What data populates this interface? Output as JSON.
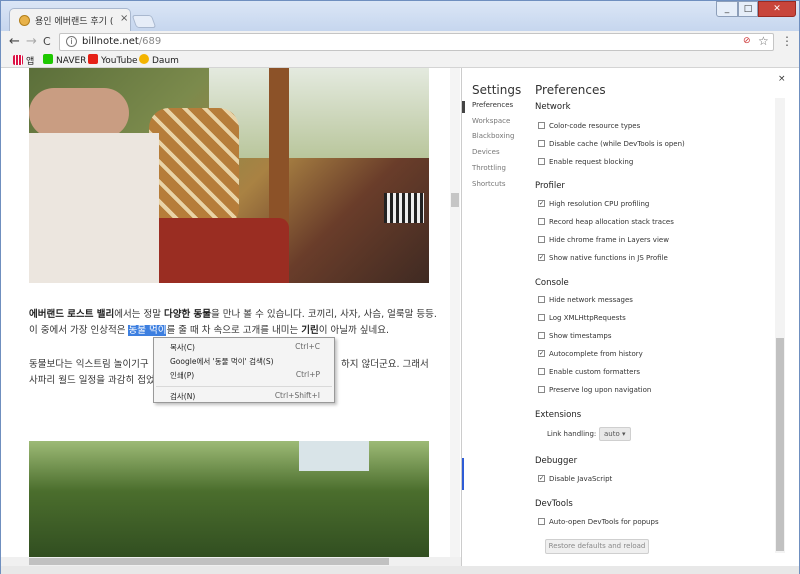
{
  "window": {
    "tab_title": "용인 에버랜드 후기 (로스",
    "tab_close": "×",
    "min_label": "_",
    "max_label": "□",
    "close_label": "✕"
  },
  "toolbar": {
    "url_host": "billnote.net",
    "url_path": "/689",
    "back": "←",
    "forward": "→",
    "reload": "C",
    "menu": "⋮",
    "star": "☆",
    "info": "i",
    "translate": "\u001a⊘"
  },
  "bookmarks": [
    {
      "label": "앱",
      "color": "#d14"
    },
    {
      "label": "NAVER",
      "color": "#1ec800"
    },
    {
      "label": "YouTube",
      "color": "#e62117"
    },
    {
      "label": "Daum",
      "color": "#f4b400"
    }
  ],
  "article": {
    "line1_a": "에버랜드 로스트 밸리",
    "line1_b": "에서는 정말 ",
    "line1_c": "다양한 동물",
    "line1_d": "을 만나 볼 수 있습니다. 코끼리, 사자, 사슴, 얼룩말 등등.",
    "line2_a": "이 중에서 가장 인상적은 ",
    "line2_sel": "동물 먹이",
    "line2_b": "를 줄 때 차 속으로 고개를 내미는 ",
    "line2_c": "기린",
    "line2_d": "이 아닐까 싶네요.",
    "line3_a": "동물보다는 익스트림 놀이기구",
    "line3_b": "하지 않더군요. 그래서",
    "line4_a": "사파리 월드 일정을 과감히 접었"
  },
  "context_menu": [
    {
      "label": "복사(C)",
      "shortcut": "Ctrl+C"
    },
    {
      "label": "Google에서 '동물 먹이' 검색(S)",
      "shortcut": ""
    },
    {
      "label": "인쇄(P)",
      "shortcut": "Ctrl+P"
    },
    {
      "label": "검사(N)",
      "shortcut": "Ctrl+Shift+I"
    }
  ],
  "devtools": {
    "close": "×",
    "settings_title": "Settings",
    "preferences_title": "Preferences",
    "side": [
      "Preferences",
      "Workspace",
      "Blackboxing",
      "Devices",
      "Throttling",
      "Shortcuts"
    ],
    "network": {
      "title": "Network",
      "options": [
        {
          "label": "Color-code resource types",
          "checked": false
        },
        {
          "label": "Disable cache (while DevTools is open)",
          "checked": false
        },
        {
          "label": "Enable request blocking",
          "checked": false
        }
      ]
    },
    "profiler": {
      "title": "Profiler",
      "options": [
        {
          "label": "High resolution CPU profiling",
          "checked": true
        },
        {
          "label": "Record heap allocation stack traces",
          "checked": false
        },
        {
          "label": "Hide chrome frame in Layers view",
          "checked": false
        },
        {
          "label": "Show native functions in JS Profile",
          "checked": true
        }
      ]
    },
    "console": {
      "title": "Console",
      "options": [
        {
          "label": "Hide network messages",
          "checked": false
        },
        {
          "label": "Log XMLHttpRequests",
          "checked": false
        },
        {
          "label": "Show timestamps",
          "checked": false
        },
        {
          "label": "Autocomplete from history",
          "checked": true
        },
        {
          "label": "Enable custom formatters",
          "checked": false
        },
        {
          "label": "Preserve log upon navigation",
          "checked": false
        }
      ]
    },
    "extensions": {
      "title": "Extensions",
      "link_handling_label": "Link handling:",
      "link_handling_value": "auto"
    },
    "debugger": {
      "title": "Debugger",
      "options": [
        {
          "label": "Disable JavaScript",
          "checked": true
        }
      ]
    },
    "devtools_sec": {
      "title": "DevTools",
      "options": [
        {
          "label": "Auto-open DevTools for popups",
          "checked": false
        }
      ]
    },
    "restore_label": "Restore defaults and reload"
  }
}
